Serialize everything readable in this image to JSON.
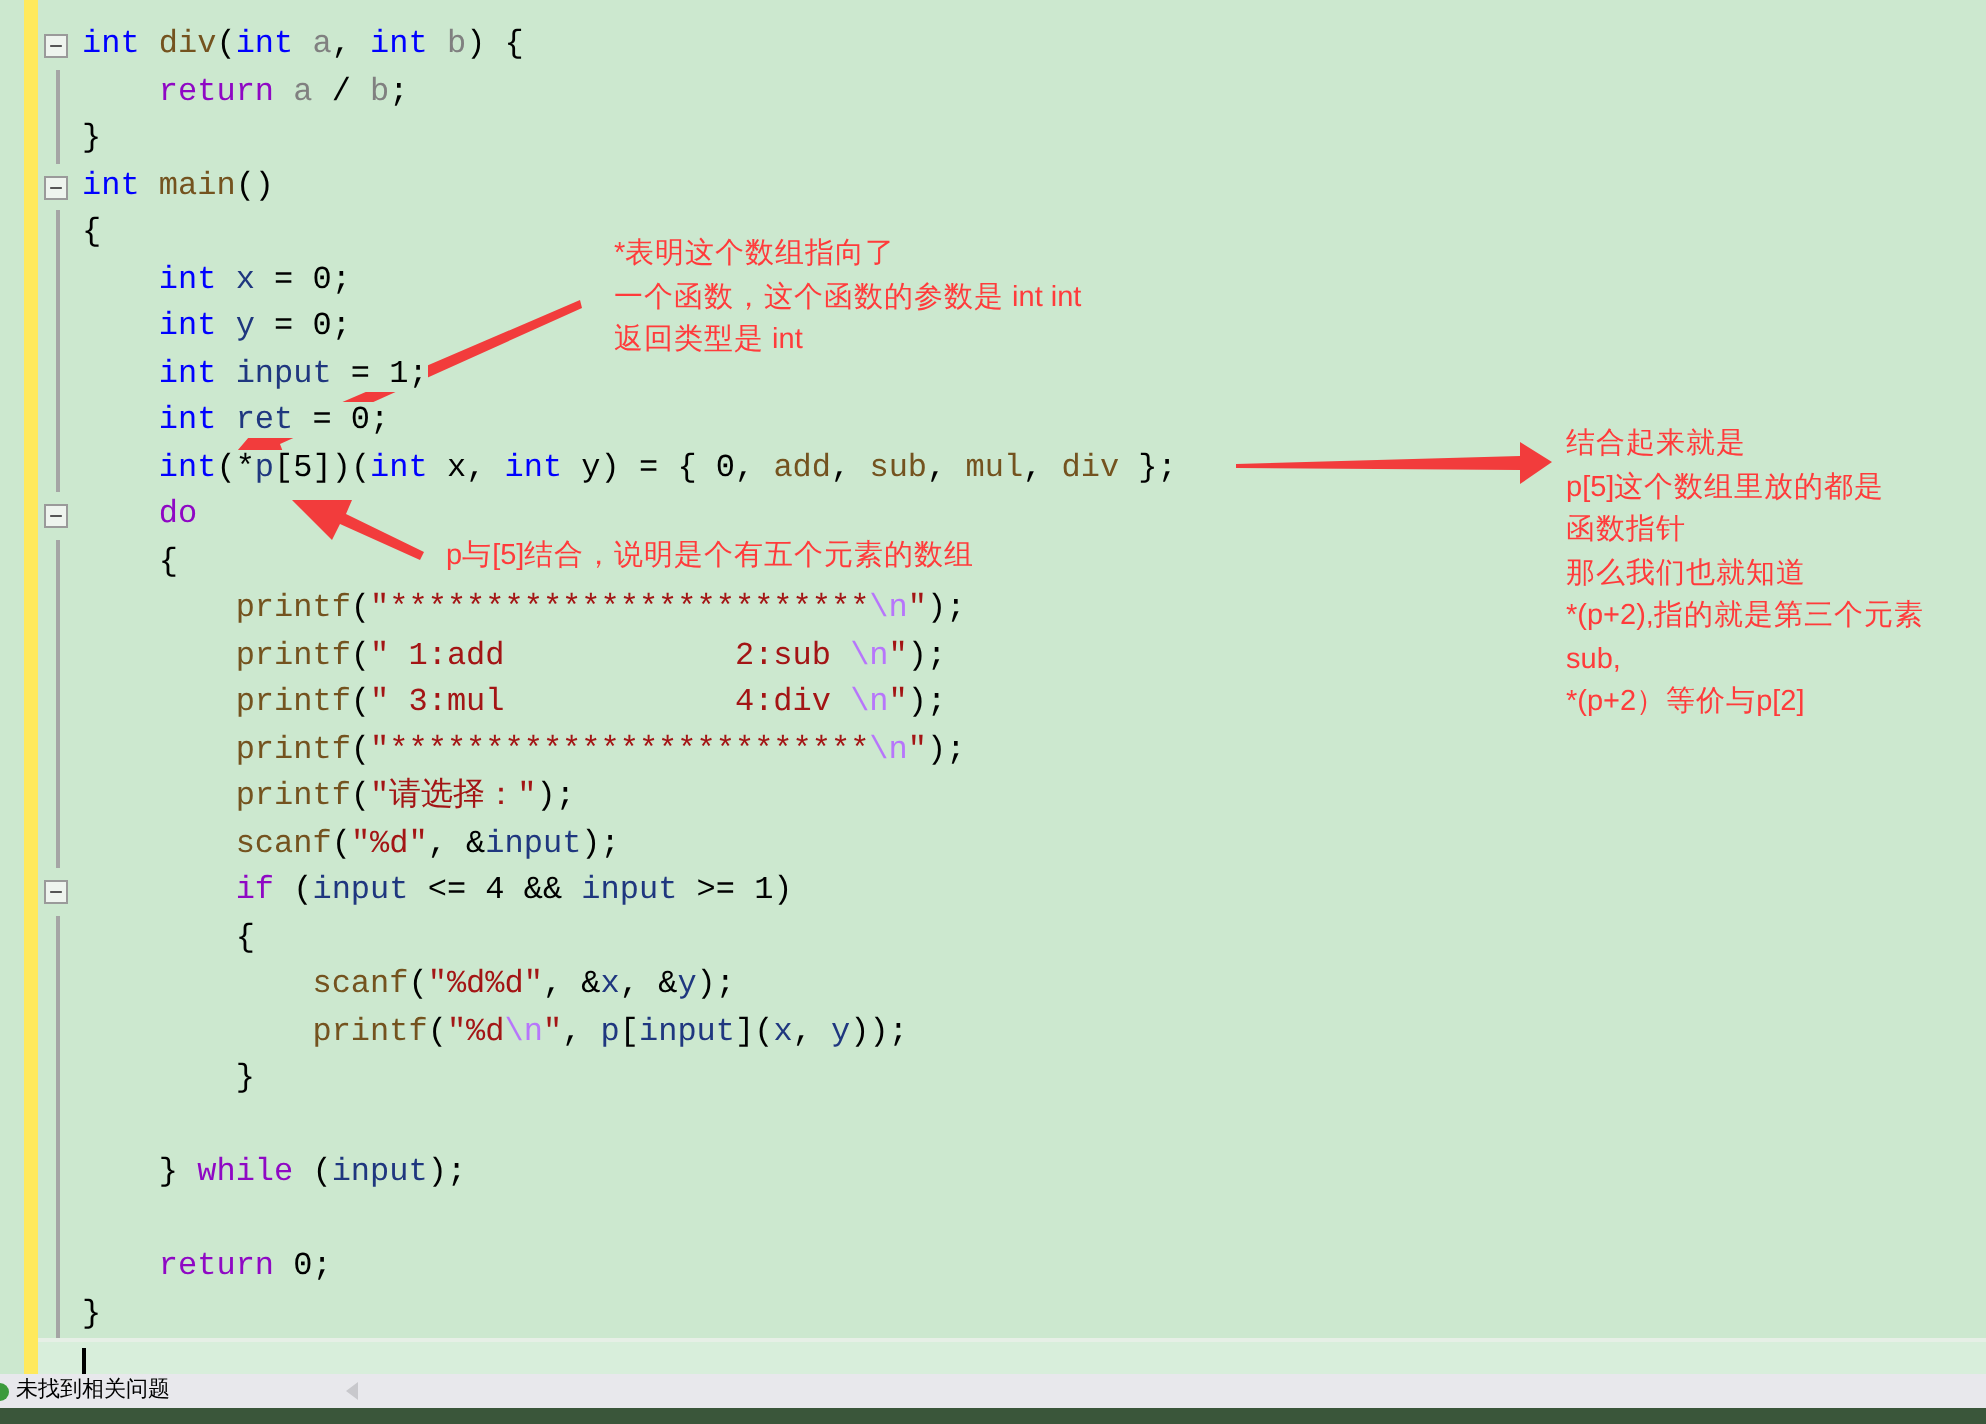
{
  "editor": {
    "lines": [
      {
        "fold": true,
        "tokens": [
          {
            "kind": "type",
            "text": "int"
          },
          {
            "kind": "func",
            "text": " div"
          },
          {
            "kind": "plain",
            "text": "("
          },
          {
            "kind": "type",
            "text": "int"
          },
          {
            "kind": "param",
            "text": " a"
          },
          {
            "kind": "plain",
            "text": ", "
          },
          {
            "kind": "type",
            "text": "int"
          },
          {
            "kind": "param",
            "text": " b"
          },
          {
            "kind": "plain",
            "text": ") {"
          }
        ]
      },
      {
        "tokens": [
          {
            "kind": "keyword",
            "text": "    return"
          },
          {
            "kind": "param",
            "text": " a"
          },
          {
            "kind": "plain",
            "text": " / "
          },
          {
            "kind": "param",
            "text": "b"
          },
          {
            "kind": "plain",
            "text": ";"
          }
        ]
      },
      {
        "tokens": [
          {
            "kind": "plain",
            "text": "}"
          }
        ]
      },
      {
        "fold": true,
        "tokens": [
          {
            "kind": "type",
            "text": "int"
          },
          {
            "kind": "func",
            "text": " main"
          },
          {
            "kind": "plain",
            "text": "()"
          }
        ]
      },
      {
        "tokens": [
          {
            "kind": "plain",
            "text": "{"
          }
        ]
      },
      {
        "tokens": [
          {
            "kind": "type",
            "text": "    int"
          },
          {
            "kind": "local",
            "text": " x"
          },
          {
            "kind": "plain",
            "text": " = 0;"
          }
        ]
      },
      {
        "tokens": [
          {
            "kind": "type",
            "text": "    int"
          },
          {
            "kind": "local",
            "text": " y"
          },
          {
            "kind": "plain",
            "text": " = 0;"
          }
        ]
      },
      {
        "tokens": [
          {
            "kind": "type",
            "text": "    int"
          },
          {
            "kind": "local",
            "text": " input"
          },
          {
            "kind": "plain",
            "text": " = 1;"
          }
        ]
      },
      {
        "tokens": [
          {
            "kind": "type",
            "text": "    int"
          },
          {
            "kind": "local",
            "text": " ret"
          },
          {
            "kind": "plain",
            "text": " = 0;"
          }
        ]
      },
      {
        "tokens": [
          {
            "kind": "type",
            "text": "    int"
          },
          {
            "kind": "plain",
            "text": "(*"
          },
          {
            "kind": "local",
            "text": "p"
          },
          {
            "kind": "plain",
            "text": "[5])("
          },
          {
            "kind": "type",
            "text": "int"
          },
          {
            "kind": "plain",
            "text": " x, "
          },
          {
            "kind": "type",
            "text": "int"
          },
          {
            "kind": "plain",
            "text": " y) = { 0, "
          },
          {
            "kind": "func",
            "text": "add"
          },
          {
            "kind": "plain",
            "text": ", "
          },
          {
            "kind": "func",
            "text": "sub"
          },
          {
            "kind": "plain",
            "text": ", "
          },
          {
            "kind": "func",
            "text": "mul"
          },
          {
            "kind": "plain",
            "text": ", "
          },
          {
            "kind": "func",
            "text": "div"
          },
          {
            "kind": "plain",
            "text": " };"
          }
        ]
      },
      {
        "fold": true,
        "tokens": [
          {
            "kind": "keyword",
            "text": "    do"
          }
        ]
      },
      {
        "tokens": [
          {
            "kind": "plain",
            "text": "    {"
          }
        ]
      },
      {
        "tokens": [
          {
            "kind": "func",
            "text": "        printf"
          },
          {
            "kind": "plain",
            "text": "("
          },
          {
            "kind": "string",
            "text": "\"*************************"
          },
          {
            "kind": "escape",
            "text": "\\n"
          },
          {
            "kind": "string",
            "text": "\""
          },
          {
            "kind": "plain",
            "text": ");"
          }
        ]
      },
      {
        "tokens": [
          {
            "kind": "func",
            "text": "        printf"
          },
          {
            "kind": "plain",
            "text": "("
          },
          {
            "kind": "string",
            "text": "\" 1:add            2:sub "
          },
          {
            "kind": "escape",
            "text": "\\n"
          },
          {
            "kind": "string",
            "text": "\""
          },
          {
            "kind": "plain",
            "text": ");"
          }
        ]
      },
      {
        "tokens": [
          {
            "kind": "func",
            "text": "        printf"
          },
          {
            "kind": "plain",
            "text": "("
          },
          {
            "kind": "string",
            "text": "\" 3:mul            4:div "
          },
          {
            "kind": "escape",
            "text": "\\n"
          },
          {
            "kind": "string",
            "text": "\""
          },
          {
            "kind": "plain",
            "text": ");"
          }
        ]
      },
      {
        "tokens": [
          {
            "kind": "func",
            "text": "        printf"
          },
          {
            "kind": "plain",
            "text": "("
          },
          {
            "kind": "string",
            "text": "\"*************************"
          },
          {
            "kind": "escape",
            "text": "\\n"
          },
          {
            "kind": "string",
            "text": "\""
          },
          {
            "kind": "plain",
            "text": ");"
          }
        ]
      },
      {
        "tokens": [
          {
            "kind": "func",
            "text": "        printf"
          },
          {
            "kind": "plain",
            "text": "("
          },
          {
            "kind": "string",
            "text": "\"请选择：\""
          },
          {
            "kind": "plain",
            "text": ");"
          }
        ]
      },
      {
        "tokens": [
          {
            "kind": "func",
            "text": "        scanf"
          },
          {
            "kind": "plain",
            "text": "("
          },
          {
            "kind": "string",
            "text": "\"%d\""
          },
          {
            "kind": "plain",
            "text": ", &"
          },
          {
            "kind": "local",
            "text": "input"
          },
          {
            "kind": "plain",
            "text": ");"
          }
        ]
      },
      {
        "fold": true,
        "tokens": [
          {
            "kind": "keyword",
            "text": "        if"
          },
          {
            "kind": "plain",
            "text": " ("
          },
          {
            "kind": "local",
            "text": "input"
          },
          {
            "kind": "plain",
            "text": " <= 4 && "
          },
          {
            "kind": "local",
            "text": "input"
          },
          {
            "kind": "plain",
            "text": " >= 1)"
          }
        ]
      },
      {
        "tokens": [
          {
            "kind": "plain",
            "text": "        {"
          }
        ]
      },
      {
        "tokens": [
          {
            "kind": "func",
            "text": "            scanf"
          },
          {
            "kind": "plain",
            "text": "("
          },
          {
            "kind": "string",
            "text": "\"%d%d\""
          },
          {
            "kind": "plain",
            "text": ", &"
          },
          {
            "kind": "local",
            "text": "x"
          },
          {
            "kind": "plain",
            "text": ", &"
          },
          {
            "kind": "local",
            "text": "y"
          },
          {
            "kind": "plain",
            "text": ");"
          }
        ]
      },
      {
        "tokens": [
          {
            "kind": "func",
            "text": "            printf"
          },
          {
            "kind": "plain",
            "text": "("
          },
          {
            "kind": "string",
            "text": "\"%d"
          },
          {
            "kind": "escape",
            "text": "\\n"
          },
          {
            "kind": "string",
            "text": "\""
          },
          {
            "kind": "plain",
            "text": ", "
          },
          {
            "kind": "local",
            "text": "p"
          },
          {
            "kind": "plain",
            "text": "["
          },
          {
            "kind": "local",
            "text": "input"
          },
          {
            "kind": "plain",
            "text": "]("
          },
          {
            "kind": "local",
            "text": "x"
          },
          {
            "kind": "plain",
            "text": ", "
          },
          {
            "kind": "local",
            "text": "y"
          },
          {
            "kind": "plain",
            "text": "));"
          }
        ]
      },
      {
        "tokens": [
          {
            "kind": "plain",
            "text": "        }"
          }
        ]
      },
      {
        "blank_before": true,
        "tokens": [
          {
            "kind": "plain",
            "text": "    }"
          },
          {
            "kind": "keyword",
            "text": " while"
          },
          {
            "kind": "plain",
            "text": " ("
          },
          {
            "kind": "local",
            "text": "input"
          },
          {
            "kind": "plain",
            "text": ");"
          }
        ]
      },
      {
        "blank_before": true,
        "tokens": [
          {
            "kind": "keyword",
            "text": "    return"
          },
          {
            "kind": "plain",
            "text": " 0;"
          }
        ]
      },
      {
        "tokens": [
          {
            "kind": "plain",
            "text": "}"
          }
        ]
      },
      {
        "current": true
      }
    ]
  },
  "annotations": [
    {
      "lines": [
        "*表明这个数组指向了",
        "一个函数，这个函数的参数是 int int",
        "返回类型是 int"
      ]
    },
    {
      "lines": [
        "p与[5]结合，说明是个有五个元素的数组"
      ]
    },
    {
      "lines": [
        "结合起来就是",
        "p[5]这个数组里放的都是",
        "函数指针",
        "那么我们也就知道",
        "*(p+2),指的就是第三个元素",
        "sub,",
        "*(p+2）等价与p[2]"
      ]
    }
  ],
  "status_bar": {
    "message": "未找到相关问题"
  }
}
